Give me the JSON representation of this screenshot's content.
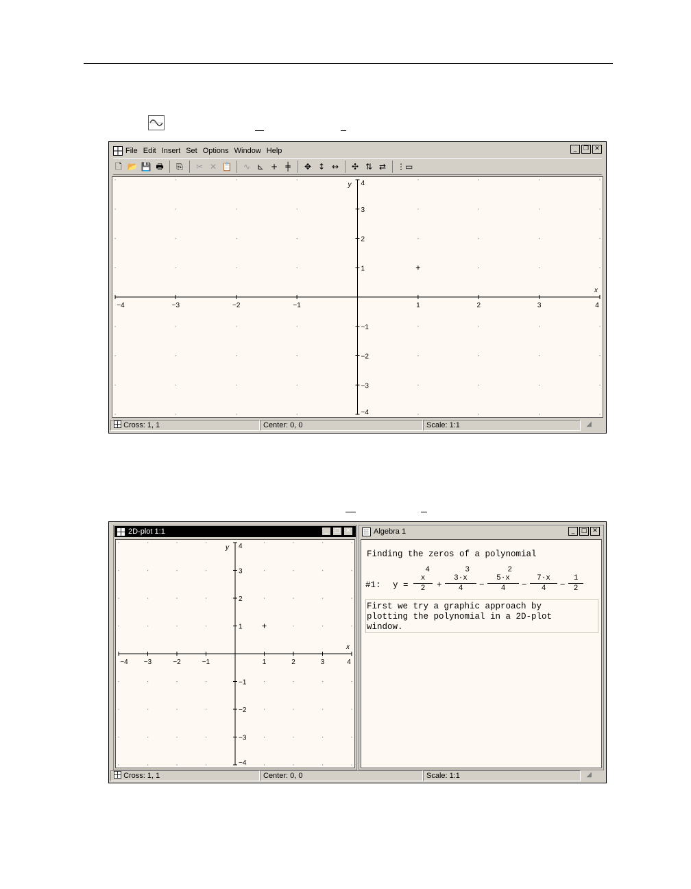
{
  "window1": {
    "menu": [
      "File",
      "Edit",
      "Insert",
      "Set",
      "Options",
      "Window",
      "Help"
    ],
    "status": {
      "cross": "Cross: 1, 1",
      "center": "Center: 0, 0",
      "scale": "Scale: 1:1"
    },
    "plot": {
      "x_ticks": [
        "−4",
        "−3",
        "−2",
        "−1",
        "1",
        "2",
        "3",
        "4"
      ],
      "y_ticks": [
        "4",
        "3",
        "2",
        "1",
        "−1",
        "−2",
        "−3",
        "−4"
      ],
      "x_label": "x",
      "y_label": "y"
    }
  },
  "window2": {
    "plot_title": "2D-plot 1:1",
    "algebra_title": "Algebra 1",
    "algebra": {
      "line1": "Finding the zeros of a polynomial",
      "expr_label": "#1:",
      "expr_lhs": "y =",
      "frac1_num": "x",
      "frac1_exp": "4",
      "frac1_den": "2",
      "op1": "+",
      "frac2_num": "3·x",
      "frac2_exp": "3",
      "frac2_den": "4",
      "op2": "−",
      "frac3_num": "5·x",
      "frac3_exp": "2",
      "frac3_den": "4",
      "op3": "−",
      "frac4_num": "7·x",
      "frac4_den": "4",
      "op4": "−",
      "frac5_num": "1",
      "frac5_den": "2",
      "note1": "First we try a graphic approach by",
      "note2": "plotting the polynomial in a 2D-plot",
      "note3": "window."
    },
    "status": {
      "cross": "Cross: 1, 1",
      "center": "Center: 0, 0",
      "scale": "Scale: 1:1"
    },
    "plot": {
      "x_ticks": [
        "−4",
        "−3",
        "−2",
        "−1",
        "1",
        "2",
        "3",
        "4"
      ],
      "y_ticks": [
        "4",
        "3",
        "2",
        "1",
        "−1",
        "−2",
        "−3",
        "−4"
      ],
      "x_label": "x",
      "y_label": "y"
    }
  }
}
